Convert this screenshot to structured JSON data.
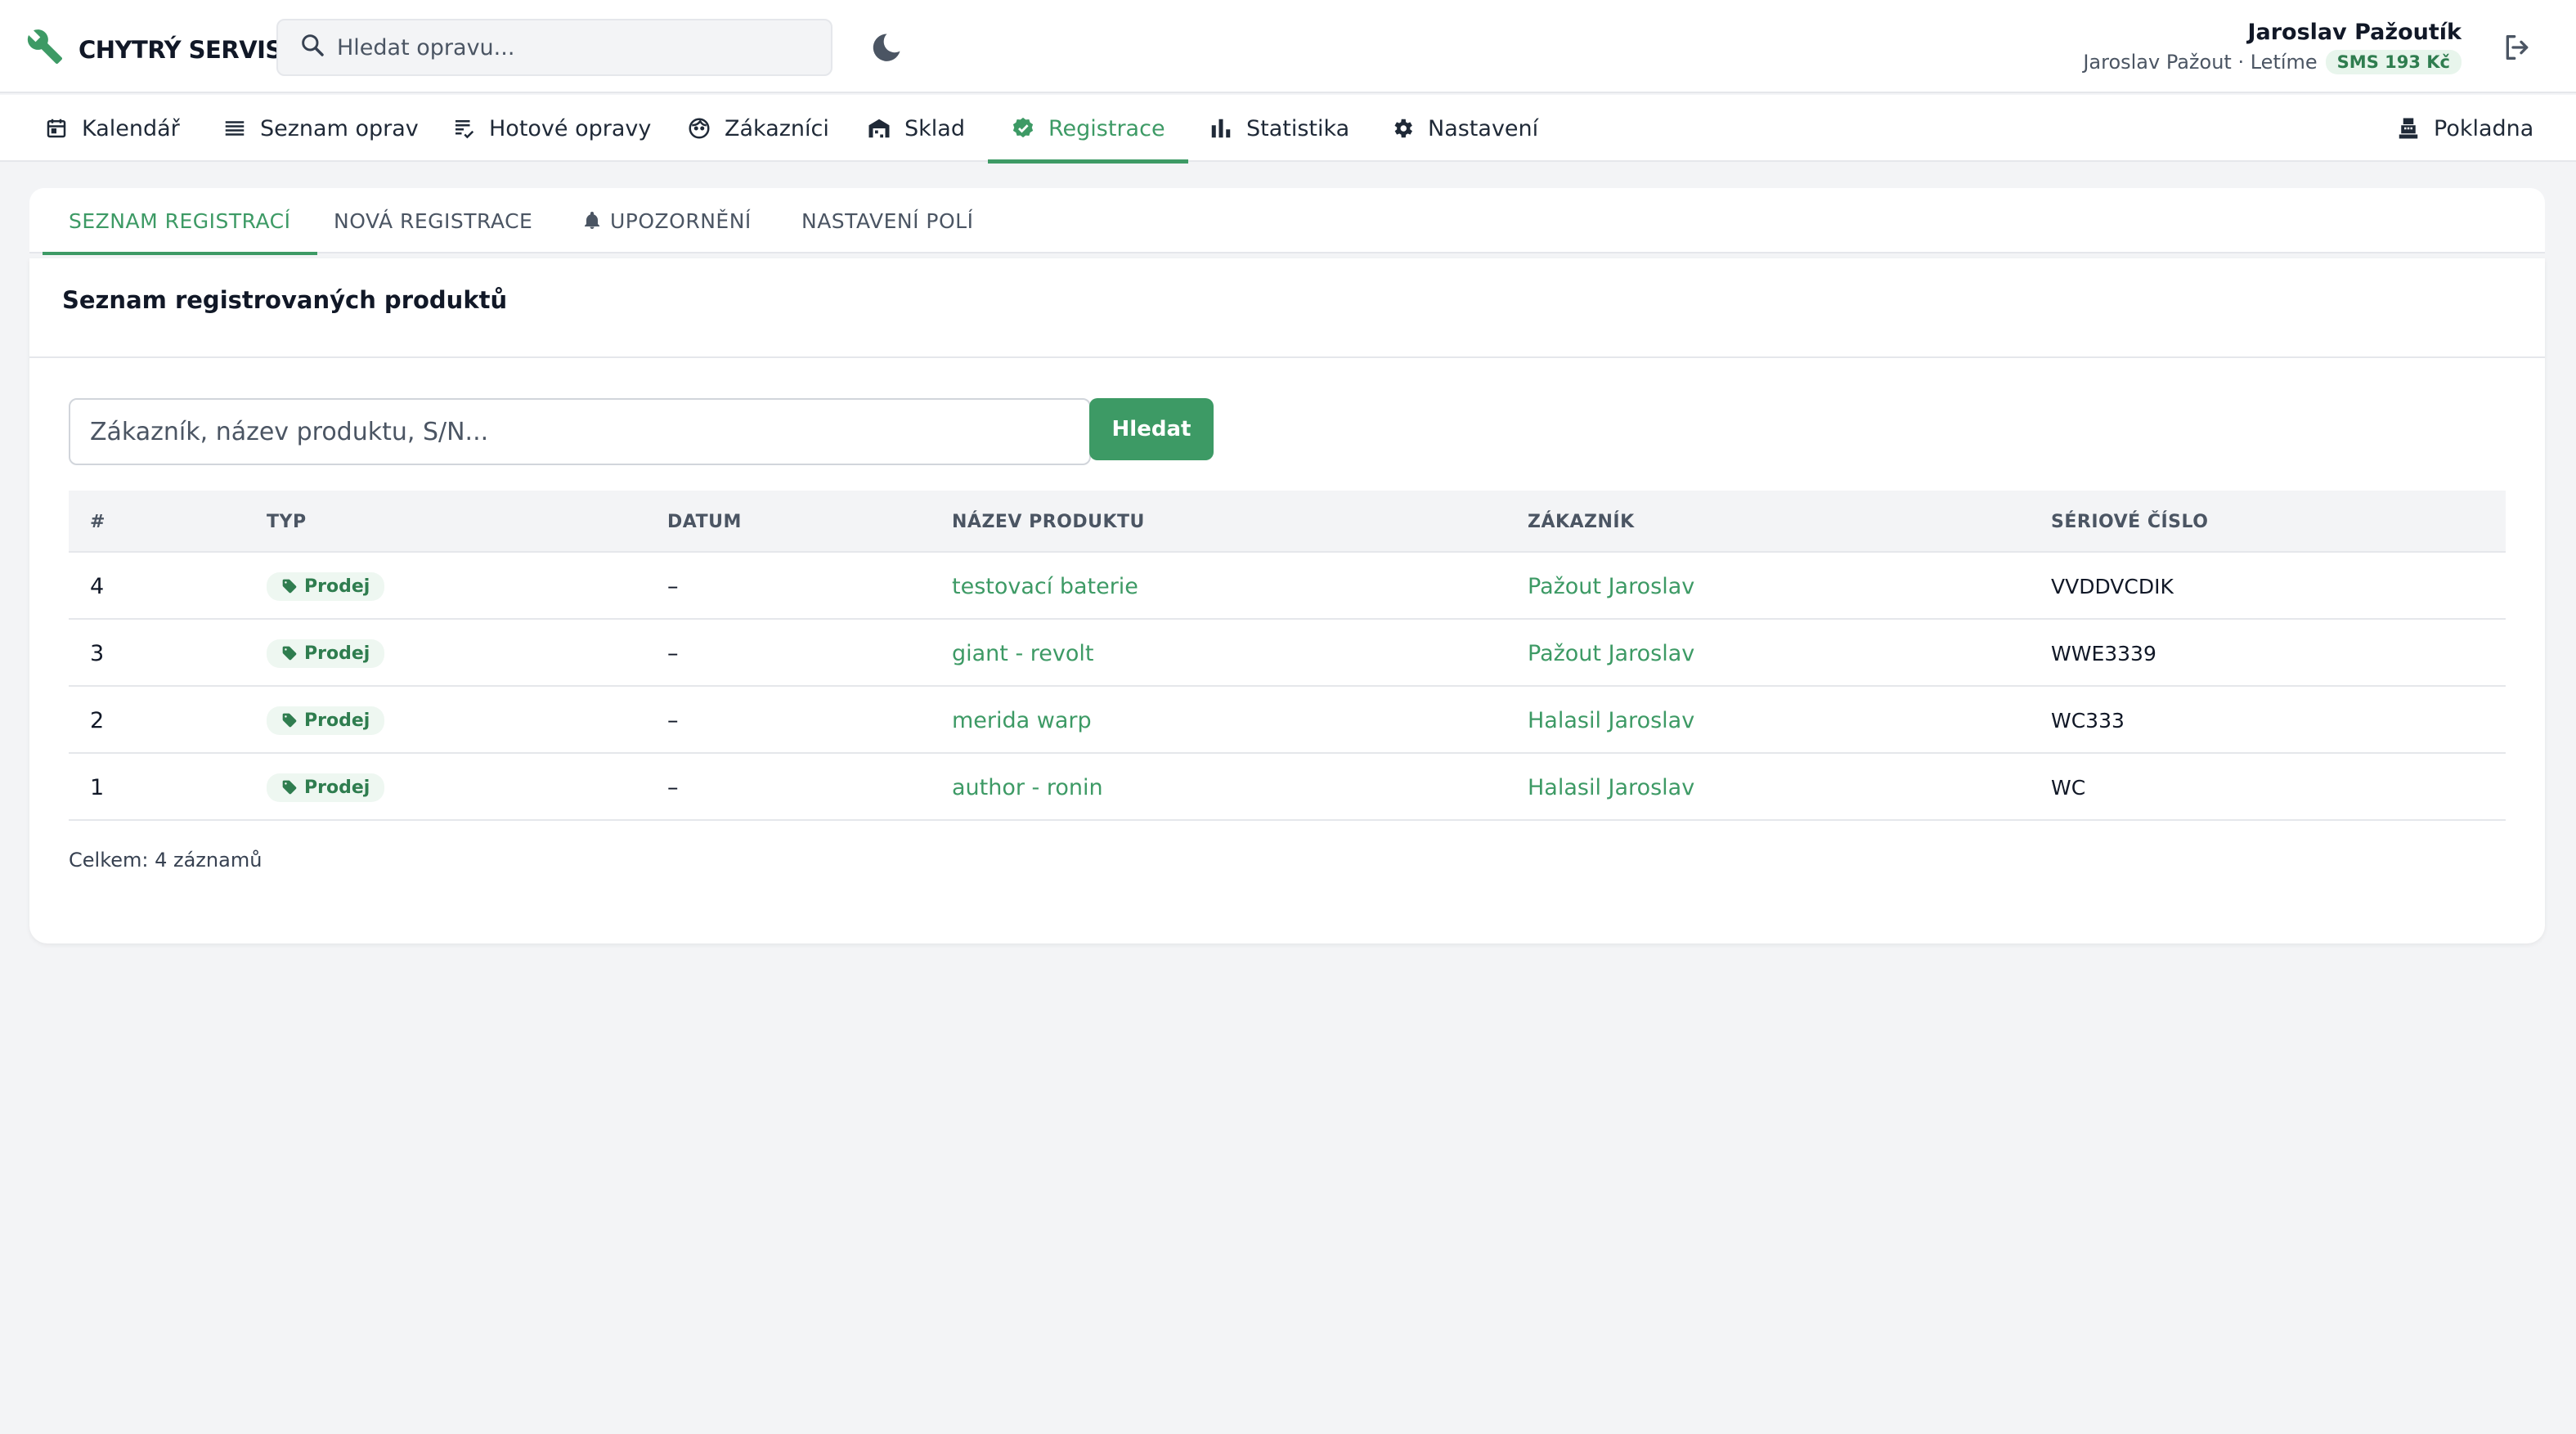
{
  "header": {
    "brand": "CHYTRÝ SERVIS",
    "search_placeholder": "Hledat opravu...",
    "user_name": "Jaroslav Pažoutík",
    "user_sub": "Jaroslav Pažout · Letíme",
    "sms_badge": "SMS 193 Kč"
  },
  "nav": {
    "items": [
      {
        "label": "Kalendář",
        "icon": "calendar-icon"
      },
      {
        "label": "Seznam oprav",
        "icon": "list-icon"
      },
      {
        "label": "Hotové opravy",
        "icon": "checklist-icon"
      },
      {
        "label": "Zákazníci",
        "icon": "face-icon"
      },
      {
        "label": "Sklad",
        "icon": "warehouse-icon"
      },
      {
        "label": "Registrace",
        "icon": "verified-icon"
      },
      {
        "label": "Statistika",
        "icon": "bar-chart-icon"
      },
      {
        "label": "Nastavení",
        "icon": "gear-icon"
      }
    ],
    "active": "Registrace",
    "right_item": "Pokladna"
  },
  "subtabs": {
    "items": [
      "SEZNAM REGISTRACÍ",
      "NOVÁ REGISTRACE",
      "UPOZORNĚNÍ",
      "NASTAVENÍ POLÍ"
    ],
    "active": "SEZNAM REGISTRACÍ"
  },
  "card": {
    "title": "Seznam registrovaných produktů",
    "filter_placeholder": "Zákazník, název produktu, S/N...",
    "filter_button": "Hledat",
    "columns": [
      "#",
      "TYP",
      "DATUM",
      "NÁZEV PRODUKTU",
      "ZÁKAZNÍK",
      "SÉRIOVÉ ČÍSLO"
    ],
    "rows": [
      {
        "num": "4",
        "type": "Prodej",
        "date": "–",
        "product": "testovací baterie",
        "customer": "Pažout Jaroslav",
        "serial": "VVDDVCDIK"
      },
      {
        "num": "3",
        "type": "Prodej",
        "date": "–",
        "product": "giant - revolt",
        "customer": "Pažout Jaroslav",
        "serial": "WWE3339"
      },
      {
        "num": "2",
        "type": "Prodej",
        "date": "–",
        "product": "merida warp",
        "customer": "Halasil Jaroslav",
        "serial": "WC333"
      },
      {
        "num": "1",
        "type": "Prodej",
        "date": "–",
        "product": "author - ronin",
        "customer": "Halasil Jaroslav",
        "serial": "WC"
      }
    ],
    "total": "Celkem: 4 záznamů"
  },
  "colors": {
    "accent": "#3d9a65",
    "badge_bg": "#eef7f1",
    "background": "#f3f4f6"
  }
}
